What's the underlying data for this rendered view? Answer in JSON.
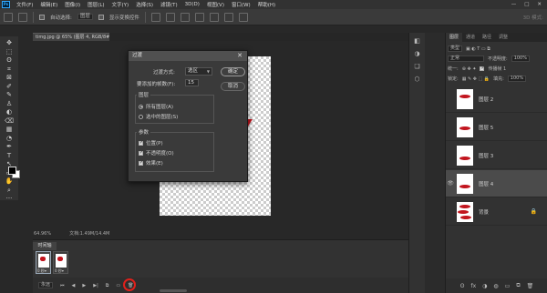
{
  "menubar": {
    "logo": "Ps",
    "items": [
      "文件(F)",
      "编辑(E)",
      "图像(I)",
      "图层(L)",
      "文字(Y)",
      "选择(S)",
      "滤镜(T)",
      "3D(D)",
      "视图(V)",
      "窗口(W)",
      "帮助(H)"
    ],
    "win_controls": [
      "—",
      "□",
      "✕"
    ]
  },
  "optionsbar": {
    "auto_select_label": "自动选择:",
    "auto_select_value": "图层",
    "show_transform": "显示变换控件",
    "mode_3d": "3D 模式:"
  },
  "document": {
    "tab_title": "timg.jpg @ 65% (图层 4, RGB/8#) *",
    "zoom": "64.96%",
    "doc_size": "文档:1.49M/14.4M"
  },
  "toolbar": {
    "tools": [
      "✥",
      "⬚",
      "ʘ",
      "⌗",
      "⊠",
      "✐",
      "✎",
      "♙",
      "◐",
      "⌫",
      "▦",
      "◔",
      "✒",
      "T",
      "↖",
      "▭",
      "✋",
      "⌕",
      "···"
    ]
  },
  "dialog": {
    "title": "过渡",
    "transition_label": "过渡方式:",
    "transition_value": "选区",
    "frames_label": "要添加的帧数(F):",
    "frames_value": "15",
    "ok_label": "确定",
    "cancel_label": "取消",
    "layers_group": "图层",
    "all_layers": "所有图层(A)",
    "selected_layers": "选中的图层(S)",
    "params_group": "参数",
    "position": "位置(P)",
    "opacity": "不透明度(O)",
    "effects": "效果(E)"
  },
  "timeline": {
    "tab": "时间轴",
    "frames": [
      {
        "index": "1",
        "time": "0 秒▾"
      },
      {
        "index": "2",
        "time": "0 秒▾"
      }
    ],
    "loop": "永远",
    "controls": [
      "⏮",
      "◀",
      "▶",
      "▶|",
      "⧉",
      "🗑"
    ]
  },
  "layers_panel": {
    "tabs": [
      "图层",
      "通道",
      "路径",
      "调整"
    ],
    "kind_label": "类型",
    "blend_mode": "正常",
    "opacity_label": "不透明度:",
    "opacity_value": "100%",
    "unify_label": "统一:",
    "propagate_label": "传播帧 1",
    "lock_label": "锁定:",
    "fill_label": "填充:",
    "fill_value": "100%",
    "layers": [
      {
        "name": "图层 2",
        "visible": false
      },
      {
        "name": "图层 5",
        "visible": false
      },
      {
        "name": "图层 3",
        "visible": false
      },
      {
        "name": "图层 4",
        "visible": true
      },
      {
        "name": "背景",
        "visible": false
      }
    ],
    "bottom_icons": [
      "ʘ",
      "fx",
      "◑",
      "◍",
      "▭",
      "⧉",
      "🗑"
    ]
  },
  "colors": {
    "accent_red": "#c2151e",
    "annotation_red": "#e0201b"
  }
}
